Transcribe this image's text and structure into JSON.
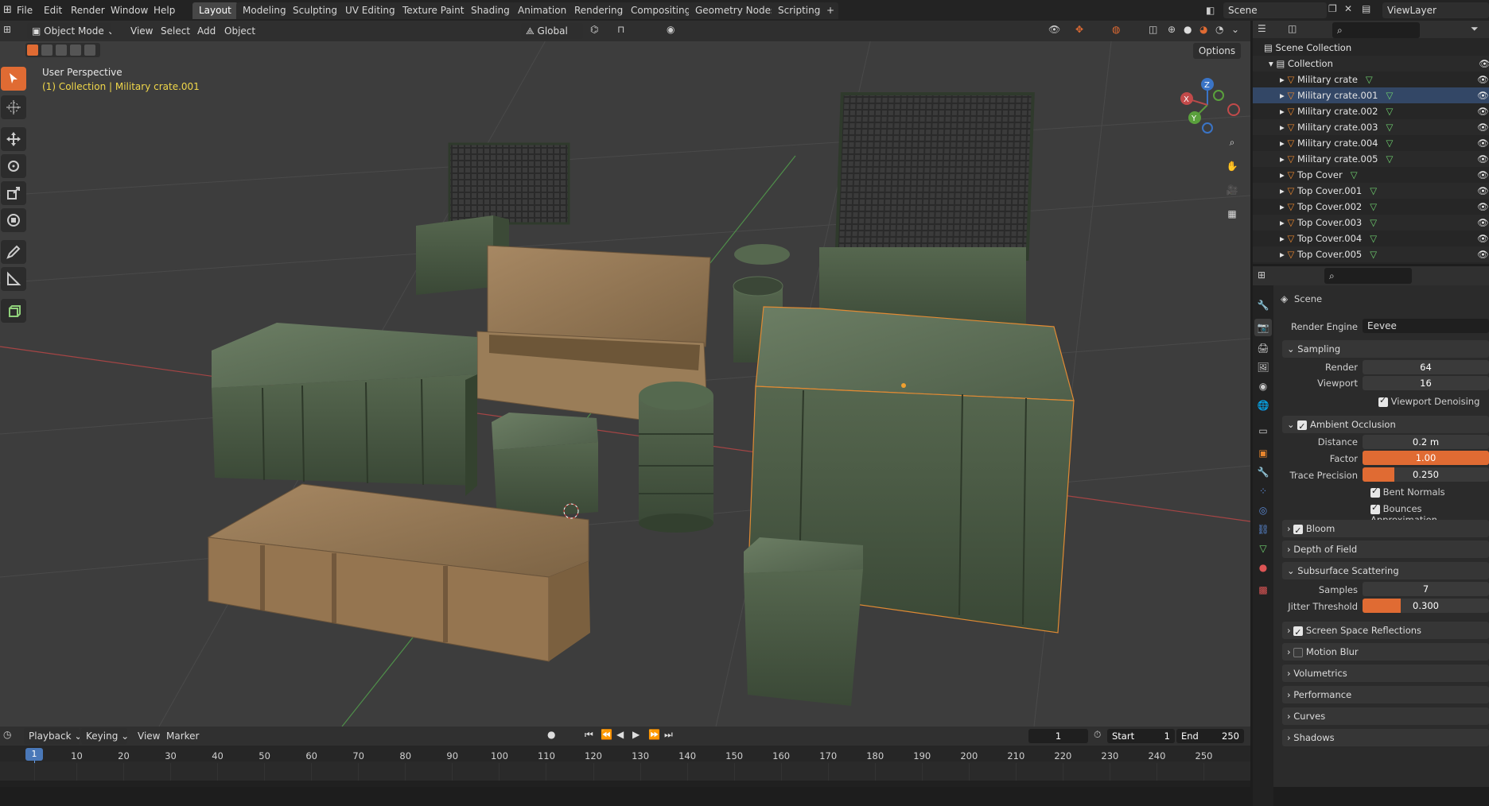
{
  "topbar": {
    "menus": [
      "File",
      "Edit",
      "Render",
      "Window",
      "Help"
    ],
    "workspaces": [
      "Layout",
      "Modeling",
      "Sculpting",
      "UV Editing",
      "Texture Paint",
      "Shading",
      "Animation",
      "Rendering",
      "Compositing",
      "Geometry Nodes",
      "Scripting"
    ],
    "active_workspace": "Layout",
    "add_tab": "+",
    "scene_name": "Scene",
    "view_layer": "ViewLayer"
  },
  "viewport": {
    "mode": "Object Mode",
    "menus": [
      "View",
      "Select",
      "Add",
      "Object"
    ],
    "transform_orientation": "Global",
    "options_label": "Options",
    "perspective_label": "User Perspective",
    "context_label": "(1) Collection | Military crate.001",
    "gizmo_axes": {
      "x": "X",
      "y": "Y",
      "z": "Z"
    }
  },
  "outliner": {
    "search_placeholder": "",
    "scene_collection": "Scene Collection",
    "collection": "Collection",
    "items": [
      {
        "name": "Military crate",
        "selected": false
      },
      {
        "name": "Military crate.001",
        "selected": true
      },
      {
        "name": "Military crate.002",
        "selected": false
      },
      {
        "name": "Military crate.003",
        "selected": false
      },
      {
        "name": "Military crate.004",
        "selected": false
      },
      {
        "name": "Military crate.005",
        "selected": false
      },
      {
        "name": "Top Cover",
        "selected": false
      },
      {
        "name": "Top Cover.001",
        "selected": false
      },
      {
        "name": "Top Cover.002",
        "selected": false
      },
      {
        "name": "Top Cover.003",
        "selected": false
      },
      {
        "name": "Top Cover.004",
        "selected": false
      },
      {
        "name": "Top Cover.005",
        "selected": false
      }
    ]
  },
  "properties": {
    "context": "Scene",
    "render_engine_label": "Render Engine",
    "render_engine": "Eevee",
    "sampling": {
      "title": "Sampling",
      "render_label": "Render",
      "render": "64",
      "viewport_label": "Viewport",
      "viewport": "16",
      "denoise_label": "Viewport Denoising",
      "denoise": true
    },
    "ao": {
      "title": "Ambient Occlusion",
      "enabled": true,
      "distance_label": "Distance",
      "distance": "0.2 m",
      "factor_label": "Factor",
      "factor": "1.00",
      "factor_fill": 1.0,
      "trace_label": "Trace Precision",
      "trace": "0.250",
      "trace_fill": 0.25,
      "bent_label": "Bent Normals",
      "bent": true,
      "bounces_label": "Bounces Approximation",
      "bounces": true
    },
    "bloom": {
      "title": "Bloom",
      "enabled": true
    },
    "dof": {
      "title": "Depth of Field"
    },
    "sss": {
      "title": "Subsurface Scattering",
      "samples_label": "Samples",
      "samples": "7",
      "jitter_label": "Jitter Threshold",
      "jitter": "0.300",
      "jitter_fill": 0.3
    },
    "ssr": {
      "title": "Screen Space Reflections",
      "enabled": true
    },
    "motion_blur": {
      "title": "Motion Blur",
      "enabled": false
    },
    "volumetrics": {
      "title": "Volumetrics"
    },
    "performance": {
      "title": "Performance"
    },
    "curves": {
      "title": "Curves"
    },
    "shadows": {
      "title": "Shadows"
    }
  },
  "timeline": {
    "menus": [
      "Playback",
      "Keying",
      "View",
      "Marker"
    ],
    "current_frame": "1",
    "start_label": "Start",
    "start": "1",
    "end_label": "End",
    "end": "250",
    "ticks": [
      "1",
      "10",
      "20",
      "30",
      "40",
      "50",
      "60",
      "70",
      "80",
      "90",
      "100",
      "110",
      "120",
      "130",
      "140",
      "150",
      "160",
      "170",
      "180",
      "190",
      "200",
      "210",
      "220",
      "230",
      "240",
      "250"
    ]
  },
  "colors": {
    "accent": "#e06b33",
    "selection": "#4a78b8",
    "highlight_text": "#f0d74a"
  }
}
